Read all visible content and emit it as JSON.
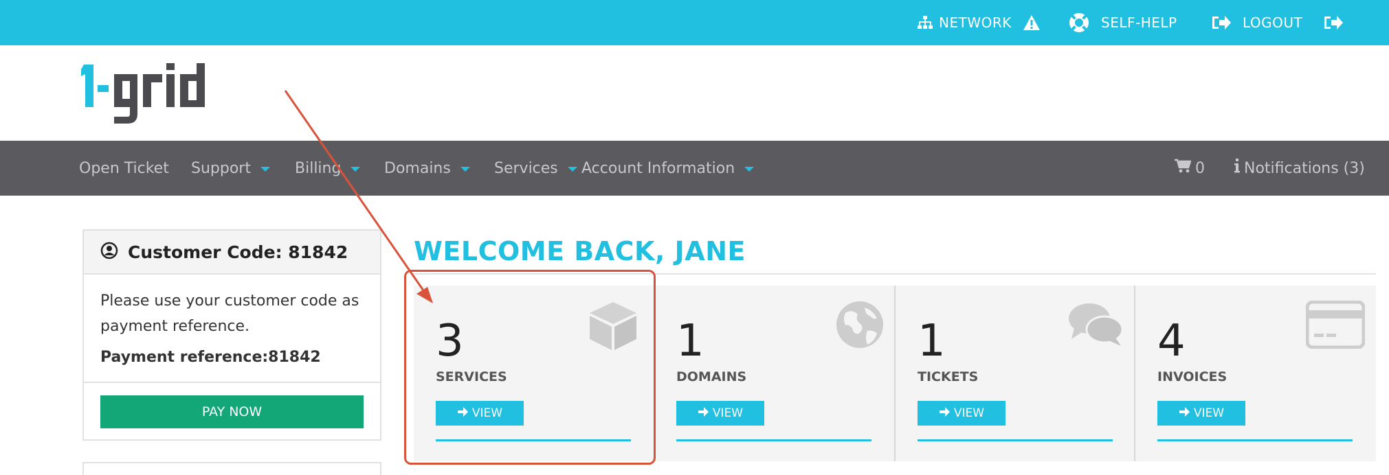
{
  "topbar": {
    "network": "NETWORK",
    "self_help": "SELF-HELP",
    "logout": "LOGOUT"
  },
  "logo": {
    "text": "1-grid"
  },
  "nav": {
    "items": [
      {
        "label": "Open Ticket",
        "has_caret": false
      },
      {
        "label": "Support",
        "has_caret": true
      },
      {
        "label": "Billing",
        "has_caret": true
      },
      {
        "label": "Domains",
        "has_caret": true
      },
      {
        "label": "Services",
        "has_caret": true
      },
      {
        "label": "Account Information",
        "has_caret": true
      }
    ],
    "cart_count": "0",
    "notifications": "Notifications (3)"
  },
  "customer": {
    "title": "Customer Code: 81842",
    "note": "Please use your customer code as payment reference.",
    "payment_ref": "Payment reference:81842",
    "pay_button": "PAY NOW"
  },
  "welcome": "WELCOME BACK, JANE",
  "cards": [
    {
      "count": "3",
      "label": "SERVICES",
      "button": "VIEW",
      "icon": "cube-icon"
    },
    {
      "count": "1",
      "label": "DOMAINS",
      "button": "VIEW",
      "icon": "globe-icon"
    },
    {
      "count": "1",
      "label": "TICKETS",
      "button": "VIEW",
      "icon": "chat-bubbles-icon"
    },
    {
      "count": "4",
      "label": "INVOICES",
      "button": "VIEW",
      "icon": "credit-card-icon"
    }
  ],
  "colors": {
    "brand": "#21bfe0",
    "nav_bg": "#5a5a5f",
    "pay_green": "#13a677",
    "annotation": "#d9533b"
  }
}
